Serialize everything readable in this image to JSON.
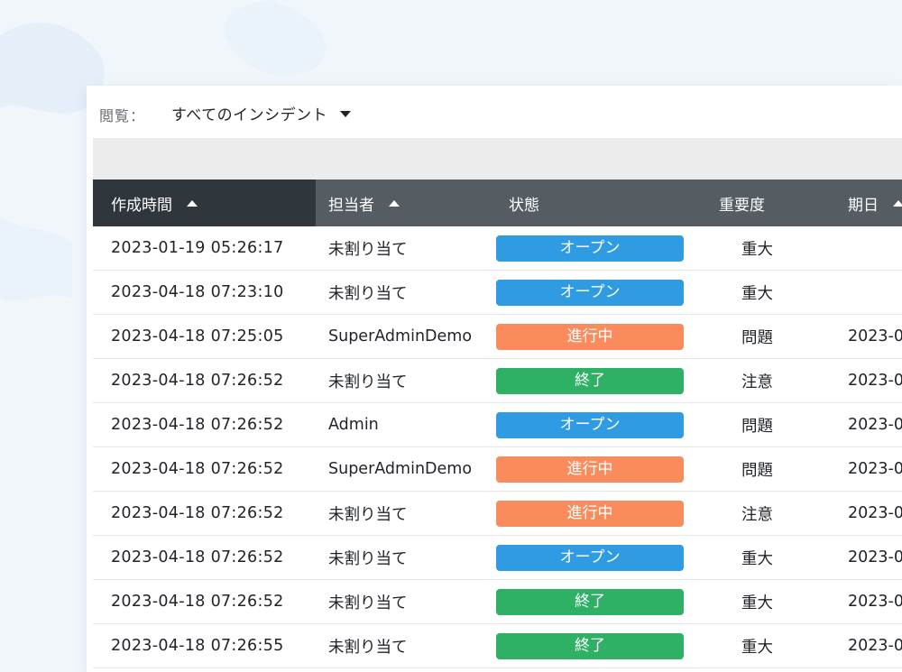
{
  "view": {
    "label": "閲覧：",
    "selected": "すべてのインシデント"
  },
  "columns": [
    {
      "label": "作成時間",
      "sortable": true
    },
    {
      "label": "担当者",
      "sortable": true
    },
    {
      "label": "状態",
      "sortable": false
    },
    {
      "label": "重要度",
      "sortable": false
    },
    {
      "label": "期日",
      "sortable": true
    }
  ],
  "status_colors": {
    "オープン": "#2f9be3",
    "進行中": "#f98b5d",
    "終了": "#2eb164"
  },
  "rows": [
    {
      "created": "2023-01-19 05:26:17",
      "assignee": "未割り当て",
      "status": "オープン",
      "severity": "重大",
      "due": ""
    },
    {
      "created": "2023-04-18 07:23:10",
      "assignee": "未割り当て",
      "status": "オープン",
      "severity": "重大",
      "due": ""
    },
    {
      "created": "2023-04-18 07:25:05",
      "assignee": "SuperAdminDemo",
      "status": "進行中",
      "severity": "問題",
      "due": "2023-0"
    },
    {
      "created": "2023-04-18 07:26:52",
      "assignee": "未割り当て",
      "status": "終了",
      "severity": "注意",
      "due": "2023-0"
    },
    {
      "created": "2023-04-18 07:26:52",
      "assignee": "Admin",
      "status": "オープン",
      "severity": "問題",
      "due": "2023-0"
    },
    {
      "created": "2023-04-18 07:26:52",
      "assignee": "SuperAdminDemo",
      "status": "進行中",
      "severity": "問題",
      "due": "2023-0"
    },
    {
      "created": "2023-04-18 07:26:52",
      "assignee": "未割り当て",
      "status": "進行中",
      "severity": "注意",
      "due": "2023-0"
    },
    {
      "created": "2023-04-18 07:26:52",
      "assignee": "未割り当て",
      "status": "オープン",
      "severity": "重大",
      "due": "2023-0"
    },
    {
      "created": "2023-04-18 07:26:52",
      "assignee": "未割り当て",
      "status": "終了",
      "severity": "重大",
      "due": "2023-0"
    },
    {
      "created": "2023-04-18 07:26:55",
      "assignee": "未割り当て",
      "status": "終了",
      "severity": "重大",
      "due": "2023-0"
    }
  ]
}
